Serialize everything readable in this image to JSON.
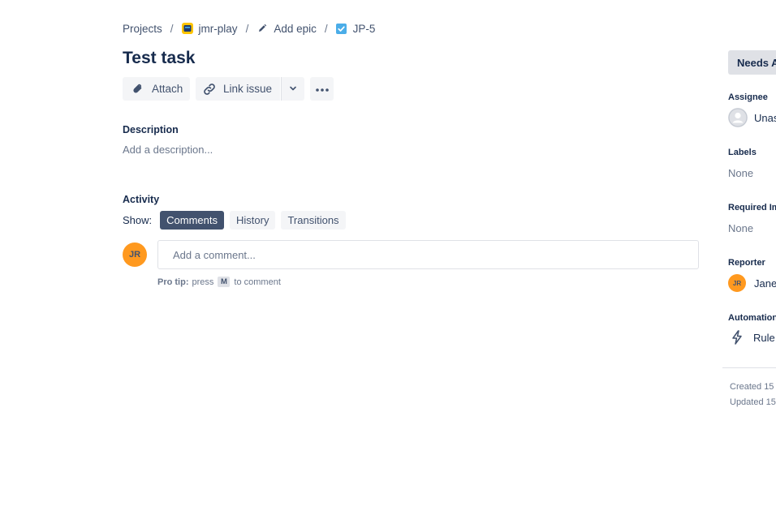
{
  "breadcrumb": {
    "projects": "Projects",
    "project": "jmr-play",
    "epic": "Add epic",
    "issue_key": "JP-5",
    "separator": "/"
  },
  "issue": {
    "title": "Test task"
  },
  "toolbar": {
    "attach_label": "Attach",
    "link_label": "Link issue"
  },
  "description": {
    "label": "Description",
    "placeholder": "Add a description..."
  },
  "activity": {
    "label": "Activity",
    "show_label": "Show:",
    "filters": [
      {
        "label": "Comments",
        "active": true
      },
      {
        "label": "History",
        "active": false
      },
      {
        "label": "Transitions",
        "active": false
      }
    ],
    "user_initials": "JR",
    "comment_placeholder": "Add a comment...",
    "protip_bold": "Pro tip:",
    "protip_text": "press",
    "protip_key": "M",
    "protip_after": "to comment"
  },
  "sidebar": {
    "status_label": "Needs A",
    "assignee_label": "Assignee",
    "assignee_value": "Unas",
    "labels_label": "Labels",
    "labels_value": "None",
    "required_label": "Required Im",
    "required_value": "None",
    "reporter_label": "Reporter",
    "reporter_initials": "JR",
    "reporter_value": "Jane",
    "automation_label": "Automation",
    "automation_value": "Rule e",
    "created": "Created 15",
    "updated": "Updated 15"
  },
  "colors": {
    "text_primary": "#172b4d",
    "text_secondary": "#42526e",
    "text_subtle": "#6b778c",
    "button_bg": "#f4f5f7",
    "active_filter_bg": "#42526e",
    "avatar_orange": "#ff991f",
    "checkbox_blue": "#4bade8"
  }
}
